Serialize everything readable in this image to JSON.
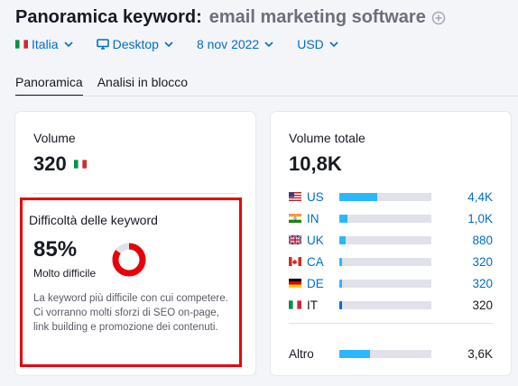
{
  "header": {
    "title": "Panoramica keyword:",
    "keyword": "email marketing software"
  },
  "filters": {
    "database": "Italia",
    "device": "Desktop",
    "date": "8 nov 2022",
    "currency": "USD"
  },
  "tabs": [
    {
      "label": "Panoramica",
      "active": true
    },
    {
      "label": "Analisi in blocco",
      "active": false
    }
  ],
  "volume": {
    "label": "Volume",
    "value": "320",
    "flag": "IT"
  },
  "keyword_difficulty": {
    "title": "Difficoltà delle keyword",
    "value": "85%",
    "percent": 85,
    "level": "Molto difficile",
    "description": "La keyword più difficile con cui competere. Ci vorranno molti sforzi di SEO on-page, link building e promozione dei contenuti."
  },
  "global_volume": {
    "label": "Volume totale",
    "value": "10,8K",
    "countries": [
      {
        "code": "US",
        "value": "4,4K",
        "share": 0.41
      },
      {
        "code": "IN",
        "value": "1,0K",
        "share": 0.09
      },
      {
        "code": "UK",
        "value": "880",
        "share": 0.07
      },
      {
        "code": "CA",
        "value": "320",
        "share": 0.03
      },
      {
        "code": "DE",
        "value": "320",
        "share": 0.03
      },
      {
        "code": "IT",
        "value": "320",
        "share": 0.03
      }
    ],
    "other": {
      "label": "Altro",
      "value": "3,6K",
      "share": 0.33
    }
  },
  "colors": {
    "link": "#006dca",
    "bar": "#2bb7fd",
    "difficulty": "#e8000b",
    "highlight_box": "#e8000b"
  }
}
